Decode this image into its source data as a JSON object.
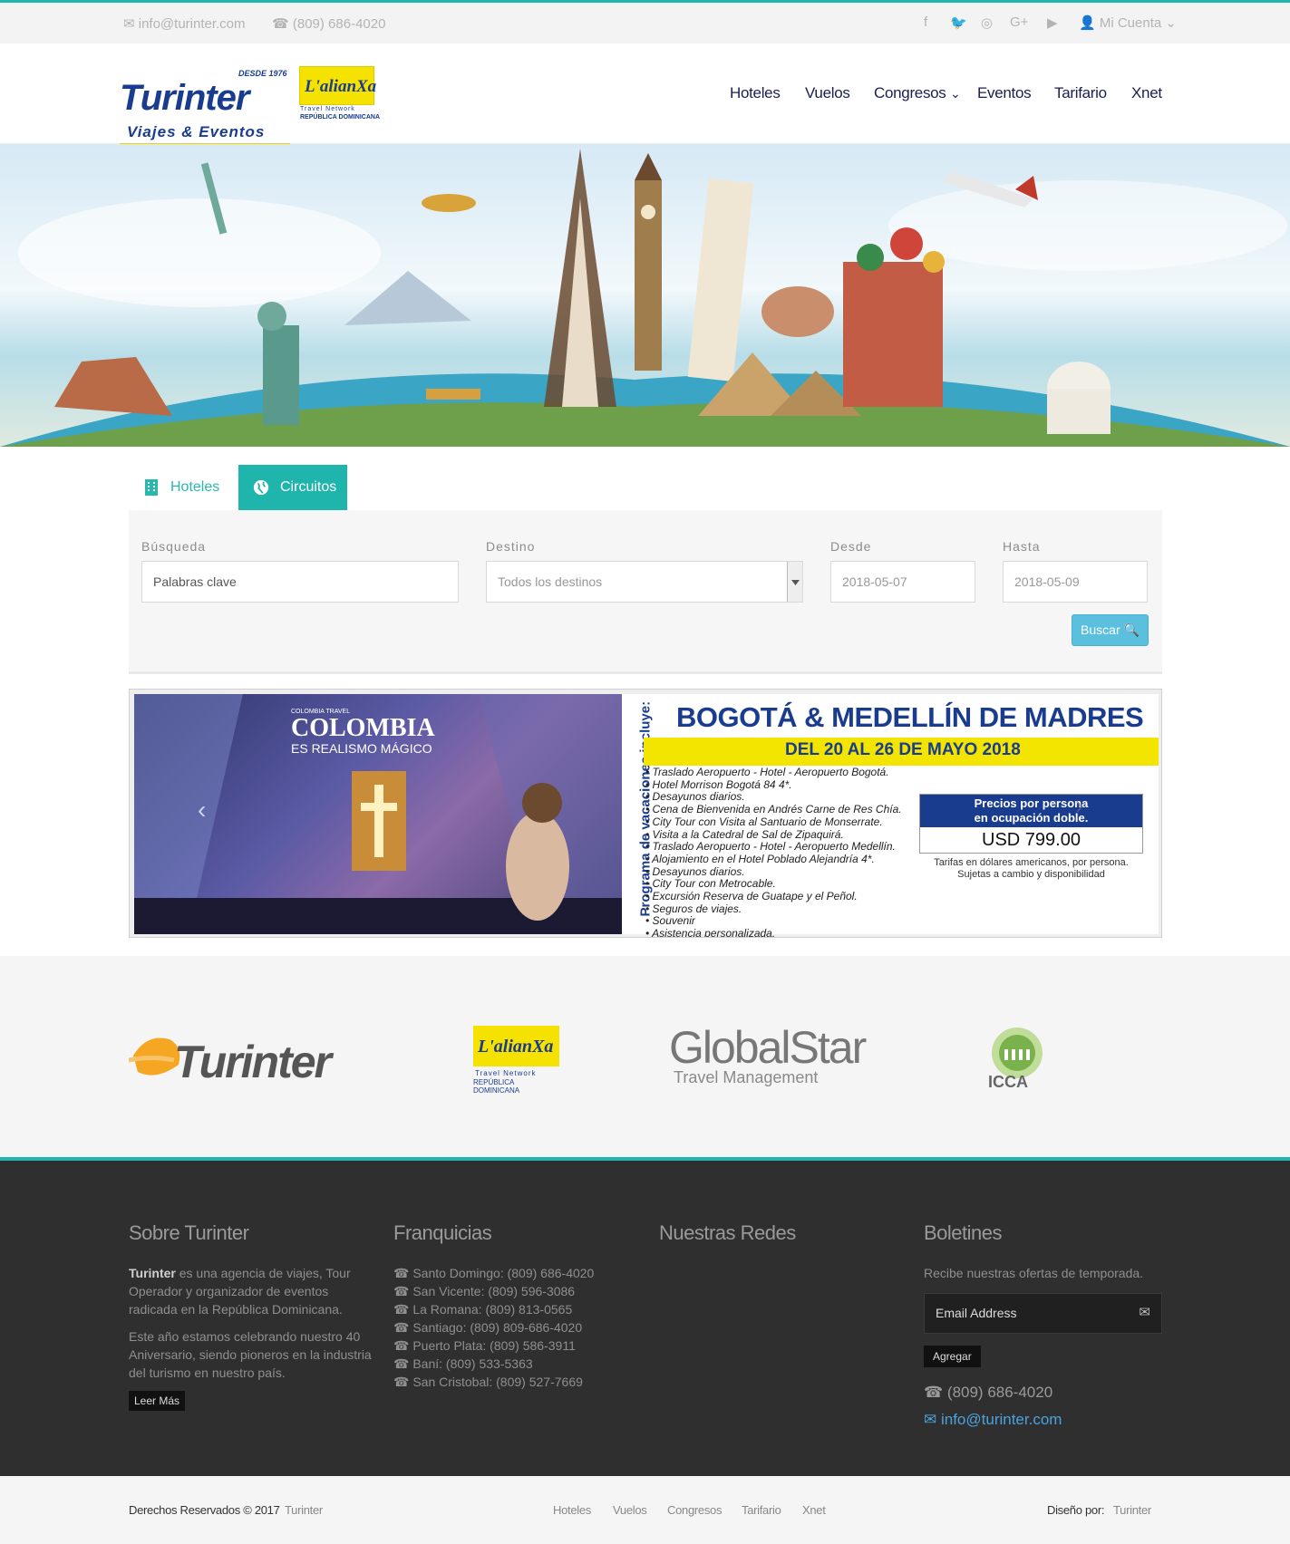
{
  "topbar": {
    "email": "info@turinter.com",
    "phone": "(809) 686-4020",
    "social_icons": [
      "facebook-icon",
      "twitter-icon",
      "instagram-icon",
      "google-plus-icon",
      "youtube-icon"
    ],
    "account_label": "Mi Cuenta"
  },
  "logo": {
    "title": "Turinter",
    "since": "DESDE 1976",
    "subtitle": "Viajes & Eventos",
    "alianza": "L'alianXa",
    "alianza_sub1": "Travel Network",
    "alianza_sub2": "REPÚBLICA DOMINICANA"
  },
  "nav": {
    "items": [
      "Hoteles",
      "Vuelos",
      "Congresos",
      "Eventos",
      "Tarifario",
      "Xnet"
    ]
  },
  "search": {
    "tabs": [
      "Hoteles",
      "Circuitos"
    ],
    "active_tab": "Circuitos",
    "busqueda_label": "Búsqueda",
    "busqueda_value": "Palabras clave",
    "destino_label": "Destino",
    "destino_value": "Todos los destinos",
    "desde_label": "Desde",
    "desde_value": "2018-05-07",
    "hasta_label": "Hasta",
    "hasta_value": "2018-05-09",
    "button": "Buscar"
  },
  "banner": {
    "photo_title": "COLOMBIA",
    "photo_sub": "ES REALISMO MÁGICO",
    "photo_tag": "COLOMBIA TRAVEL",
    "vertical": "Programa de vacaciones incluye:",
    "title": "BOGOTÁ & MEDELLÍN DE MADRES",
    "dates": "DEL 20 AL 26 DE MAYO 2018",
    "items": [
      "• Traslado Aeropuerto - Hotel - Aeropuerto Bogotá.",
      "• Hotel Morrison Bogotá 84 4*.",
      "• Desayunos diarios.",
      "• Cena de Bienvenida en Andrés Carne de Res Chía.",
      "• City Tour con Visita al Santuario de Monserrate.",
      "• Visita a la Catedral de Sal de Zipaquirá.",
      "• Traslado Aeropuerto - Hotel - Aeropuerto Medellín.",
      "• Alojamiento en el Hotel Poblado Alejandría 4*.",
      "• Desayunos diarios.",
      "• City Tour con Metrocable.",
      "• Excursión Reserva de Guatape y el Peñol.",
      "• Seguros de viajes.",
      "• Souvenir",
      "• Asistencia personalizada."
    ],
    "price_head1": "Precios por persona",
    "price_head2": "en ocupación doble.",
    "price": "USD 799.00",
    "note1": "Tarifas en dólares americanos, por persona.",
    "note2": "Sujetas a cambio y disponibilidad"
  },
  "partners": {
    "turinter": "Turinter",
    "alianza": "L'alianXa",
    "alianza_sub1": "Travel Network",
    "alianza_sub2": "REPÚBLICA DOMINICANA",
    "globalstar": "GlobalStar",
    "globalstar_sub": "Travel Management",
    "icca": "ICCA"
  },
  "footer": {
    "about_title": "Sobre Turinter",
    "about_bold": "Turinter",
    "about_text": " es una agencia de viajes, Tour Operador y organizador de eventos radicada en la República Dominicana.",
    "about_text2": "Este año estamos celebrando nuestro 40 Aniversario, siendo pioneros en la industria del turismo en nuestro país.",
    "read_more": "Leer Más",
    "franchise_title": "Franquicias",
    "franchises": [
      "Santo Domingo: (809) 686-4020",
      "San Vicente: (809) 596-3086",
      "La Romana: (809) 813-0565",
      "Santiago: (809) 809-686-4020",
      "Puerto Plata: (809) 586-3911",
      "Baní: (809) 533-5363",
      "San Cristobal: (809) 527-7669"
    ],
    "social_title": "Nuestras Redes",
    "newsletter_title": "Boletines",
    "newsletter_text": "Recibe nuestras ofertas de temporada.",
    "email_placeholder": "Email Address",
    "add_button": "Agregar",
    "phone": "(809) 686-4020",
    "email": "info@turinter.com"
  },
  "bottombar": {
    "rights": "Derechos Reservados © 2017",
    "brand": "Turinter",
    "links": [
      "Hoteles",
      "Vuelos",
      "Congresos",
      "Tarifario",
      "Xnet"
    ],
    "design_by": "Diseño por:",
    "designer": "Turinter"
  }
}
